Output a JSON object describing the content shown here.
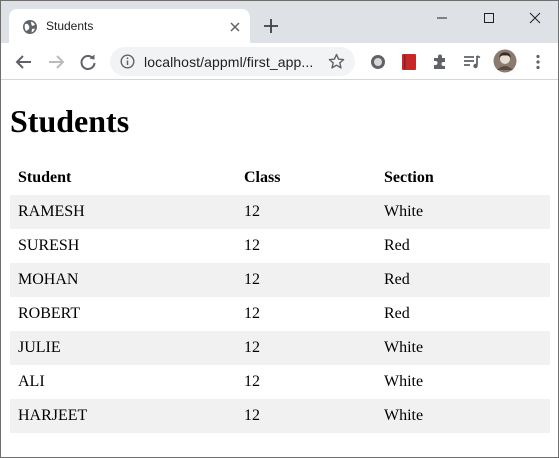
{
  "browser": {
    "tab_title": "Students",
    "url": "localhost/appml/first_app...",
    "icons": [
      "globe-favicon",
      "close-icon",
      "new-tab-icon",
      "minimize-icon",
      "maximize-icon",
      "window-close-icon",
      "back-icon",
      "forward-icon",
      "reload-icon",
      "info-icon",
      "star-icon",
      "extension-circle-icon",
      "book-icon",
      "puzzle-icon",
      "media-queue-icon",
      "profile-avatar",
      "menu-dots-icon"
    ]
  },
  "page": {
    "heading": "Students",
    "table": {
      "headers": [
        "Student",
        "Class",
        "Section"
      ],
      "rows": [
        [
          "RAMESH",
          "12",
          "White"
        ],
        [
          "SURESH",
          "12",
          "Red"
        ],
        [
          "MOHAN",
          "12",
          "Red"
        ],
        [
          "ROBERT",
          "12",
          "Red"
        ],
        [
          "JULIE",
          "12",
          "White"
        ],
        [
          "ALI",
          "12",
          "White"
        ],
        [
          "HARJEET",
          "12",
          "White"
        ]
      ]
    }
  },
  "colors": {
    "tab_strip": "#dee1e6",
    "omnibox": "#f1f3f4",
    "striped_row": "#f1f1f1"
  }
}
